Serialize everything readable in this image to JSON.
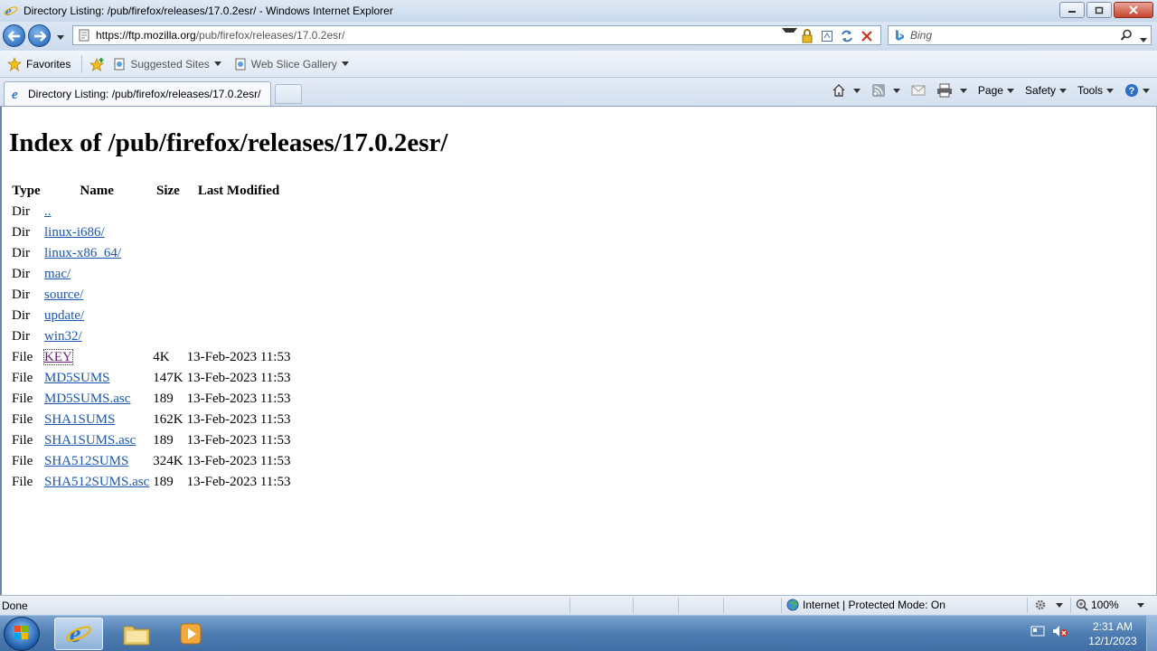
{
  "window": {
    "title": "Directory Listing: /pub/firefox/releases/17.0.2esr/ - Windows Internet Explorer"
  },
  "nav": {
    "url_host": "https://ftp.mozilla.org",
    "url_path": "/pub/firefox/releases/17.0.2esr/",
    "search_placeholder": "Bing"
  },
  "favorites_bar": {
    "favorites_label": "Favorites",
    "suggested_label": "Suggested Sites",
    "webslice_label": "Web Slice Gallery"
  },
  "tabs": {
    "active_label": "Directory Listing: /pub/firefox/releases/17.0.2esr/"
  },
  "commands": {
    "page_label": "Page",
    "safety_label": "Safety",
    "tools_label": "Tools"
  },
  "page": {
    "heading": "Index of /pub/firefox/releases/17.0.2esr/",
    "columns": [
      "Type",
      "Name",
      "Size",
      "Last Modified"
    ],
    "rows": [
      {
        "type": "Dir",
        "name": "..",
        "size": "",
        "modified": ""
      },
      {
        "type": "Dir",
        "name": "linux-i686/",
        "size": "",
        "modified": ""
      },
      {
        "type": "Dir",
        "name": "linux-x86_64/",
        "size": "",
        "modified": ""
      },
      {
        "type": "Dir",
        "name": "mac/",
        "size": "",
        "modified": ""
      },
      {
        "type": "Dir",
        "name": "source/",
        "size": "",
        "modified": ""
      },
      {
        "type": "Dir",
        "name": "update/",
        "size": "",
        "modified": ""
      },
      {
        "type": "Dir",
        "name": "win32/",
        "size": "",
        "modified": ""
      },
      {
        "type": "File",
        "name": "KEY",
        "size": "4K",
        "modified": "13-Feb-2023 11:53"
      },
      {
        "type": "File",
        "name": "MD5SUMS",
        "size": "147K",
        "modified": "13-Feb-2023 11:53"
      },
      {
        "type": "File",
        "name": "MD5SUMS.asc",
        "size": "189",
        "modified": "13-Feb-2023 11:53"
      },
      {
        "type": "File",
        "name": "SHA1SUMS",
        "size": "162K",
        "modified": "13-Feb-2023 11:53"
      },
      {
        "type": "File",
        "name": "SHA1SUMS.asc",
        "size": "189",
        "modified": "13-Feb-2023 11:53"
      },
      {
        "type": "File",
        "name": "SHA512SUMS",
        "size": "324K",
        "modified": "13-Feb-2023 11:53"
      },
      {
        "type": "File",
        "name": "SHA512SUMS.asc",
        "size": "189",
        "modified": "13-Feb-2023 11:53"
      }
    ]
  },
  "status": {
    "text": "Done",
    "zone": "Internet | Protected Mode: On",
    "zoom": "100%"
  },
  "taskbar": {
    "time": "2:31 AM",
    "date": "12/1/2023"
  },
  "colors": {
    "link": "#1a56b0",
    "visited_link": "#6b1e78"
  }
}
